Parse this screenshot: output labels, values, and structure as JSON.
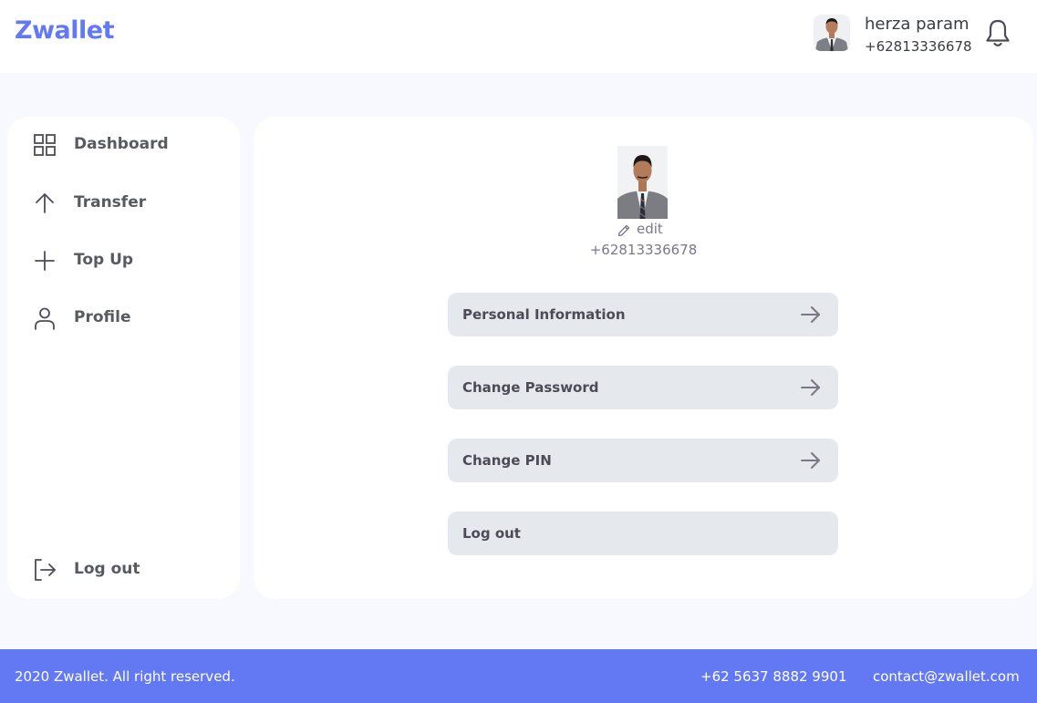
{
  "header": {
    "brand": "Zwallet",
    "user_name": "herza param",
    "user_phone": "+62813336678"
  },
  "sidebar": {
    "items": [
      {
        "label": "Dashboard",
        "icon": "grid-icon"
      },
      {
        "label": "Transfer",
        "icon": "arrow-up-icon"
      },
      {
        "label": "Top Up",
        "icon": "plus-icon"
      },
      {
        "label": "Profile",
        "icon": "user-icon"
      }
    ],
    "logout_label": "Log out"
  },
  "profile": {
    "edit_label": "edit",
    "phone": "+62813336678",
    "menu": [
      {
        "label": "Personal Information",
        "arrow": true
      },
      {
        "label": "Change Password",
        "arrow": true
      },
      {
        "label": "Change PIN",
        "arrow": true
      },
      {
        "label": "Log out",
        "arrow": false
      }
    ]
  },
  "footer": {
    "copyright": "2020 Zwallet. All right reserved.",
    "phone": "+62 5637 8882 9901",
    "email": "contact@zwallet.com"
  },
  "colors": {
    "brand": "#6379F4",
    "page_background": "#F8F9FE",
    "menu_button": "#E5E8ED",
    "text": "#3A3D42"
  }
}
